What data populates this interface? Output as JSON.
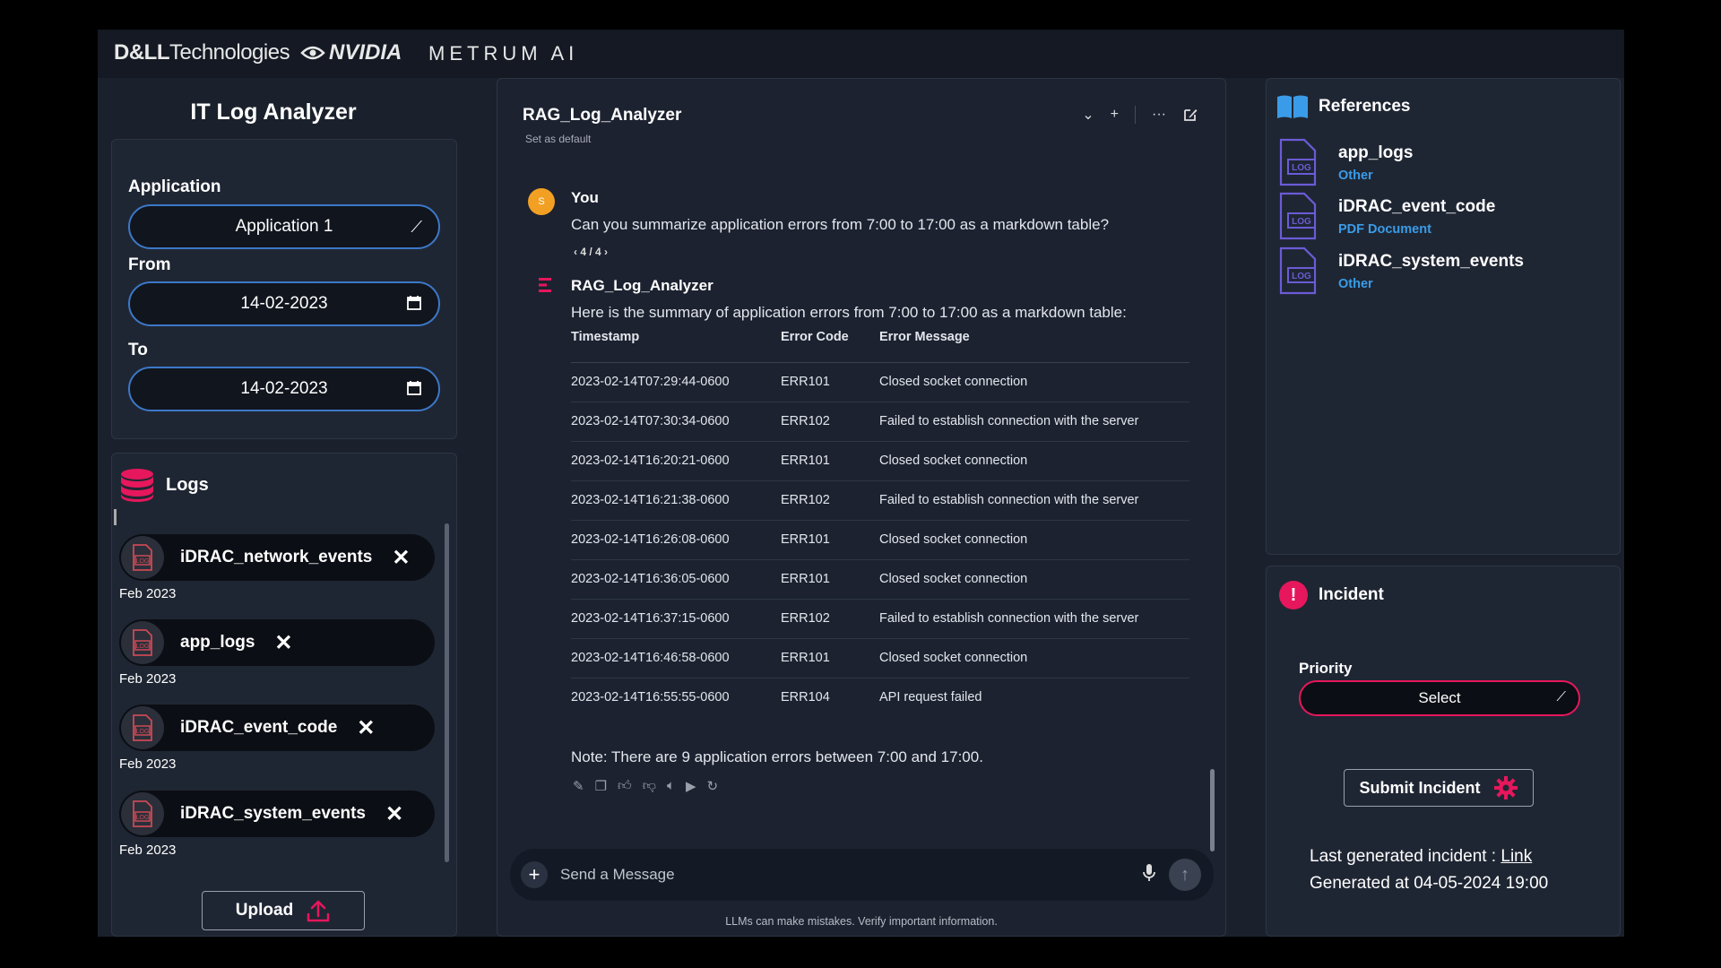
{
  "branding": {
    "dell_bold": "D&LL",
    "dell_rest": "Technologies",
    "nvidia": "NVIDIA",
    "metrum": "METRUM AI"
  },
  "left": {
    "title": "IT Log Analyzer",
    "application_label": "Application",
    "application_value": "Application 1",
    "from_label": "From",
    "from_value": "14-02-2023",
    "to_label": "To",
    "to_value": "14-02-2023",
    "logs_title": "Logs",
    "logs": [
      {
        "name": "iDRAC_network_events",
        "date": "Feb 2023"
      },
      {
        "name": "app_logs",
        "date": "Feb 2023"
      },
      {
        "name": "iDRAC_event_code",
        "date": "Feb 2023"
      },
      {
        "name": "iDRAC_system_events",
        "date": "Feb 2023"
      }
    ],
    "upload_label": "Upload"
  },
  "chat": {
    "model_name": "RAG_Log_Analyzer",
    "set_default": "Set as default",
    "user_initial": "S",
    "user_name": "You",
    "user_message": "Can you summarize application errors from 7:00 to 17:00 as a markdown table?",
    "pager": "4 / 4",
    "bot_name": "RAG_Log_Analyzer",
    "bot_intro": "Here is the summary of application errors from 7:00 to 17:00 as a markdown table:",
    "table": {
      "headers": [
        "Timestamp",
        "Error Code",
        "Error Message"
      ],
      "rows": [
        [
          "2023-02-14T07:29:44-0600",
          "ERR101",
          "Closed socket connection"
        ],
        [
          "2023-02-14T07:30:34-0600",
          "ERR102",
          "Failed to establish connection with the server"
        ],
        [
          "2023-02-14T16:20:21-0600",
          "ERR101",
          "Closed socket connection"
        ],
        [
          "2023-02-14T16:21:38-0600",
          "ERR102",
          "Failed to establish connection with the server"
        ],
        [
          "2023-02-14T16:26:08-0600",
          "ERR101",
          "Closed socket connection"
        ],
        [
          "2023-02-14T16:36:05-0600",
          "ERR101",
          "Closed socket connection"
        ],
        [
          "2023-02-14T16:37:15-0600",
          "ERR102",
          "Failed to establish connection with the server"
        ],
        [
          "2023-02-14T16:46:58-0600",
          "ERR101",
          "Closed socket connection"
        ],
        [
          "2023-02-14T16:55:55-0600",
          "ERR104",
          "API request failed"
        ]
      ]
    },
    "bot_note": "Note: There are 9 application errors between 7:00 and 17:00.",
    "input_placeholder": "Send a Message",
    "disclaimer": "LLMs can make mistakes. Verify important information."
  },
  "references": {
    "title": "References",
    "items": [
      {
        "name": "app_logs",
        "type": "Other"
      },
      {
        "name": "iDRAC_event_code",
        "type": "PDF Document"
      },
      {
        "name": "iDRAC_system_events",
        "type": "Other"
      }
    ]
  },
  "incident": {
    "title": "Incident",
    "priority_label": "Priority",
    "priority_value": "Select",
    "submit_label": "Submit Incident",
    "last_generated_label": "Last generated incident : ",
    "last_generated_link": "Link",
    "generated_at": "Generated at 04-05-2024 19:00"
  },
  "colors": {
    "accent_pink": "#e6175c",
    "accent_blue": "#3c78c8",
    "ref_type_blue": "#3a9ce8",
    "log_icon_red": "#c94a55",
    "ref_icon_purple": "#6b5bd6"
  }
}
